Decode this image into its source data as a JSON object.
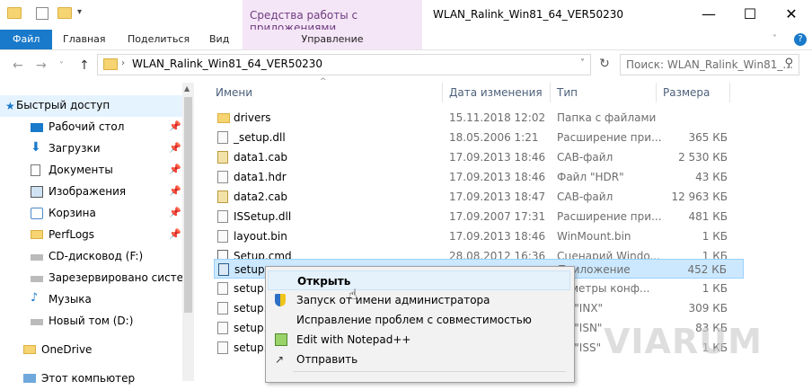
{
  "window": {
    "title": "WLAN_Ralink_Win81_64_VER50230",
    "tool_context": "Средства работы с приложениями",
    "buttons": {
      "minimize": "—",
      "maximize": "☐",
      "close": "✕"
    }
  },
  "ribbon": {
    "tabs": [
      "Файл",
      "Главная",
      "Поделиться",
      "Вид",
      "Управление"
    ],
    "help": "?"
  },
  "address": {
    "path": "WLAN_Ralink_Win81_64_VER50230",
    "search_placeholder": "Поиск: WLAN_Ralink_Win81_..."
  },
  "sidebar": {
    "items": [
      {
        "label": "Быстрый доступ",
        "icon": "star-icon",
        "pinned": false
      },
      {
        "label": "Рабочий стол",
        "icon": "desktop-icon",
        "pinned": true
      },
      {
        "label": "Загрузки",
        "icon": "download-icon",
        "pinned": true
      },
      {
        "label": "Документы",
        "icon": "documents-icon",
        "pinned": true
      },
      {
        "label": "Изображения",
        "icon": "pictures-icon",
        "pinned": true
      },
      {
        "label": "Корзина",
        "icon": "recycle-bin-icon",
        "pinned": true
      },
      {
        "label": "PerfLogs",
        "icon": "folder-icon",
        "pinned": true
      },
      {
        "label": "CD-дисковод (F:)",
        "icon": "cd-drive-icon",
        "pinned": false
      },
      {
        "label": "Зарезервировано системой",
        "icon": "drive-icon",
        "pinned": false
      },
      {
        "label": "Музыка",
        "icon": "music-icon",
        "pinned": false
      },
      {
        "label": "Новый том (D:)",
        "icon": "drive-icon",
        "pinned": false
      },
      {
        "label": "OneDrive",
        "icon": "folder-icon",
        "pinned": false
      },
      {
        "label": "Этот компьютер",
        "icon": "computer-icon",
        "pinned": false
      }
    ],
    "pin_glyph": "📌"
  },
  "columns": {
    "name": "Имени",
    "date": "Дата изменения",
    "type": "Тип",
    "size": "Размера"
  },
  "files": [
    {
      "name": "drivers",
      "date": "15.11.2018 12:02",
      "type": "Папка с файлами",
      "size": ""
    },
    {
      "name": "_setup.dll",
      "date": "18.05.2006 1:21",
      "type": "Расширение при...",
      "size": "365 КБ"
    },
    {
      "name": "data1.cab",
      "date": "17.09.2013 18:46",
      "type": "CAB-файл",
      "size": "2 530 КБ"
    },
    {
      "name": "data1.hdr",
      "date": "17.09.2013 18:46",
      "type": "Файл \"HDR\"",
      "size": "43 КБ"
    },
    {
      "name": "data2.cab",
      "date": "17.09.2013 18:47",
      "type": "CAB-файл",
      "size": "12 963 КБ"
    },
    {
      "name": "ISSetup.dll",
      "date": "17.09.2007 17:31",
      "type": "Расширение при...",
      "size": "481 КБ"
    },
    {
      "name": "layout.bin",
      "date": "17.09.2013 18:46",
      "type": "WinMount.bin",
      "size": "1 КБ"
    },
    {
      "name": "Setup.cmd",
      "date": "28.08.2012 16:36",
      "type": "Сценарий Windo...",
      "size": "1 КБ"
    },
    {
      "name": "setup.e",
      "date": "",
      "type": "Приложение",
      "size": "452 КБ"
    },
    {
      "name": "setup.i",
      "date": "",
      "type": "раметры конф...",
      "size": "1 КБ"
    },
    {
      "name": "setup.i",
      "date": "",
      "type": "йл \"INX\"",
      "size": "309 КБ"
    },
    {
      "name": "setup.i",
      "date": "",
      "type": "йл \"ISN\"",
      "size": "83 КБ"
    },
    {
      "name": "setup.i",
      "date": "",
      "type": "йл \"ISS\"",
      "size": "1 КБ"
    }
  ],
  "context_menu": {
    "items": [
      "Открыть",
      "Запуск от имени администратора",
      "Исправление проблем с совместимостью",
      "Edit with Notepad++",
      "Отправить"
    ]
  },
  "watermark": "VIARUM"
}
